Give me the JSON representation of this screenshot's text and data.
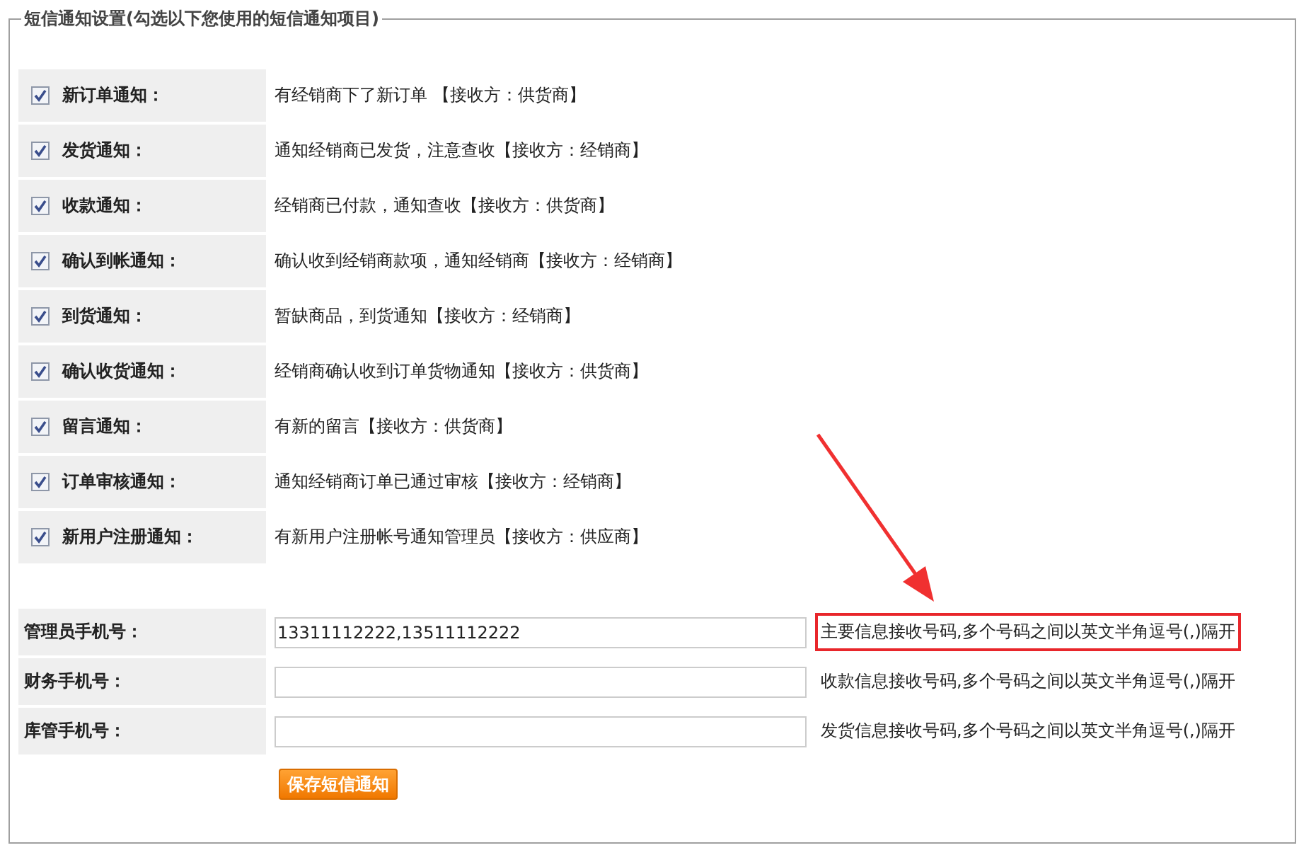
{
  "fieldset": {
    "legend": "短信通知设置(勾选以下您使用的短信通知项目)"
  },
  "notices": [
    {
      "label": "新订单通知：",
      "checked": true,
      "description": "有经销商下了新订单 【接收方：供货商】"
    },
    {
      "label": "发货通知：",
      "checked": true,
      "description": "通知经销商已发货，注意查收【接收方：经销商】"
    },
    {
      "label": "收款通知：",
      "checked": true,
      "description": "经销商已付款，通知查收【接收方：供货商】"
    },
    {
      "label": "确认到帐通知：",
      "checked": true,
      "description": "确认收到经销商款项，通知经销商【接收方：经销商】"
    },
    {
      "label": "到货通知：",
      "checked": true,
      "description": "暂缺商品，到货通知【接收方：经销商】"
    },
    {
      "label": "确认收货通知：",
      "checked": true,
      "description": "经销商确认收到订单货物通知【接收方：供货商】"
    },
    {
      "label": "留言通知：",
      "checked": true,
      "description": "有新的留言【接收方：供货商】"
    },
    {
      "label": "订单审核通知：",
      "checked": true,
      "description": "通知经销商订单已通过审核【接收方：经销商】"
    },
    {
      "label": "新用户注册通知：",
      "checked": true,
      "description": "有新用户注册帐号通知管理员【接收方：供应商】"
    }
  ],
  "phones": [
    {
      "label": "管理员手机号：",
      "value": "13311112222,13511112222",
      "hint": "主要信息接收号码,多个号码之间以英文半角逗号(,)隔开",
      "highlighted": true
    },
    {
      "label": "财务手机号：",
      "hint": "收款信息接收号码,多个号码之间以英文半角逗号(,)隔开",
      "highlighted": false
    },
    {
      "label": "库管手机号：",
      "hint": "发货信息接收号码,多个号码之间以英文半角逗号(,)隔开",
      "highlighted": false
    }
  ],
  "save_button": "保存短信通知"
}
